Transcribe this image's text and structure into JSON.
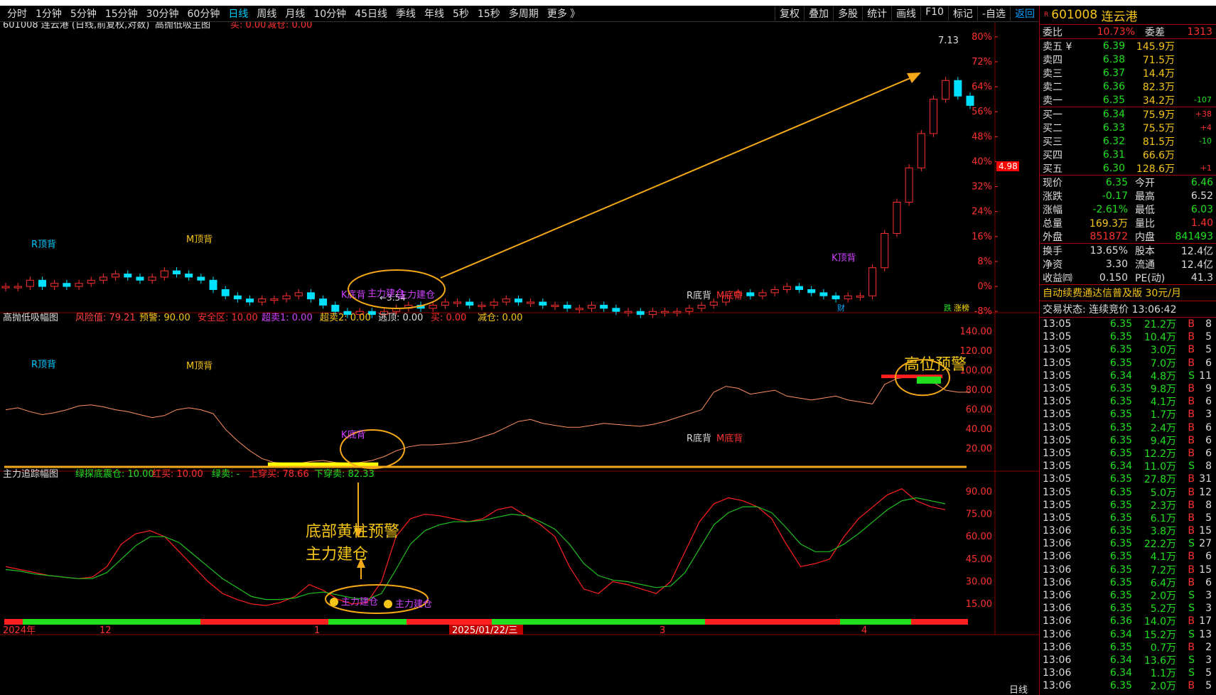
{
  "toolbar": {
    "periods": [
      "分时",
      "1分钟",
      "5分钟",
      "15分钟",
      "30分钟",
      "60分钟",
      "日线",
      "周线",
      "月线",
      "10分钟",
      "45日线",
      "季线",
      "年线",
      "5秒",
      "15秒",
      "多周期",
      "更多 》"
    ],
    "active_period": "日线",
    "right_items": [
      "复权",
      "叠加",
      "多股",
      "统计",
      "画线",
      "F10",
      "标记",
      "-自选",
      "返回"
    ]
  },
  "main_chart": {
    "title": "601008 连云港 (日线,前复权,对数)",
    "indicator_name": "高抛低吸主图",
    "buy_label": "买: 0.00",
    "reduce_label": "减仓: 0.00",
    "high_label": "7.13",
    "low_label": "←3.54",
    "price_tag": "4.98",
    "y_ticks": [
      "80%",
      "72%",
      "64%",
      "56%",
      "48%",
      "40%",
      "32%",
      "24%",
      "16%",
      "8%",
      "0%",
      "-8%"
    ],
    "signals": [
      "R顶背",
      "M顶背",
      "K底背",
      "主力建仓",
      "主力建仓",
      "K顶背",
      "R底背",
      "M底背"
    ],
    "events": [
      "财",
      "跌",
      "涨榜"
    ]
  },
  "sub1": {
    "name": "高抛低吸幅图",
    "params": [
      {
        "label": "风险值: 79.21",
        "color": "#ff4040"
      },
      {
        "label": "预警: 90.00",
        "color": "#f5c518"
      },
      {
        "label": "安全区: 10.00",
        "color": "#ff3030"
      },
      {
        "label": "超卖1: 0.00",
        "color": "#d040ff"
      },
      {
        "label": "超卖2: 0.00",
        "color": "#f5c518"
      },
      {
        "label": "逃顶: 0.00",
        "color": "#dddddd"
      },
      {
        "label": "买: 0.00",
        "color": "#ff3030"
      },
      {
        "label": "减仓: 0.00",
        "color": "#f5c518"
      }
    ],
    "y_ticks": [
      "140.00",
      "120.00",
      "100.00",
      "80.00",
      "60.00",
      "40.00",
      "20.00"
    ],
    "annotation_high": "高位预警",
    "signals": [
      "R顶背",
      "M顶背",
      "K底背",
      "R底背",
      "M底背"
    ]
  },
  "sub2": {
    "name": "主力追踪幅图",
    "params": [
      {
        "label": "绿探底震仓: 10.00",
        "color": "#20e020"
      },
      {
        "label": "红买: 10.00",
        "color": "#ff3030"
      },
      {
        "label": "绿卖: -",
        "color": "#20e020"
      },
      {
        "label": "上穿买: 78.66",
        "color": "#ff3030"
      },
      {
        "label": "下穿卖: 82.33",
        "color": "#20e020"
      }
    ],
    "y_ticks": [
      "90.00",
      "75.00",
      "60.00",
      "45.00",
      "30.00",
      "15.00"
    ],
    "annotation_line1": "底部黄柱预警",
    "annotation_line2": "主力建仓",
    "signals": [
      "主力建仓",
      "主力建仓"
    ]
  },
  "x_axis": {
    "labels": [
      "2024年",
      "12",
      "1",
      "2025/01/22/三",
      "3",
      "4"
    ],
    "period_label": "日线"
  },
  "chart_data": [
    {
      "type": "candlestick",
      "title": "601008 连云港 (日线,前复权,对数)",
      "ylabel": "%",
      "ylim": [
        -10,
        82
      ],
      "log_scale": true,
      "note_high": 7.13,
      "note_low": 3.54,
      "close_pct": [
        0,
        0,
        2,
        0,
        1,
        0,
        1,
        2,
        3,
        4,
        3,
        2,
        3,
        5,
        4,
        3,
        2,
        -1,
        -3,
        -4,
        -5,
        -4,
        -4,
        -3,
        -2,
        -4,
        -6,
        -8,
        -9,
        -8,
        -9,
        -8,
        -7,
        -6,
        -7,
        -6,
        -5,
        -5,
        -6,
        -6,
        -5,
        -4,
        -5,
        -5,
        -6,
        -6,
        -7,
        -7,
        -6,
        -7,
        -8,
        -8,
        -9,
        -8,
        -8,
        -8,
        -7,
        -6,
        -5,
        -3,
        -2,
        -3,
        -2,
        -1,
        0,
        -1,
        -2,
        -3,
        -4,
        -3,
        -3,
        6,
        17,
        27,
        38,
        49,
        60,
        66,
        61,
        58
      ]
    },
    {
      "type": "line",
      "name": "风险值",
      "ylim": [
        0,
        150
      ],
      "values": [
        60,
        62,
        58,
        55,
        57,
        60,
        64,
        65,
        63,
        60,
        58,
        55,
        52,
        54,
        60,
        62,
        60,
        56,
        40,
        28,
        18,
        10,
        6,
        5,
        5,
        7,
        8,
        6,
        5,
        6,
        8,
        12,
        18,
        22,
        24,
        24,
        25,
        26,
        28,
        32,
        36,
        42,
        48,
        50,
        46,
        44,
        42,
        42,
        44,
        46,
        45,
        44,
        43,
        45,
        48,
        52,
        56,
        60,
        78,
        84,
        82,
        76,
        78,
        80,
        74,
        72,
        70,
        72,
        74,
        70,
        68,
        66,
        86,
        92,
        94,
        92,
        88,
        80,
        78,
        78
      ]
    },
    {
      "type": "line",
      "name": "主力追踪",
      "ylim": [
        5,
        100
      ],
      "series": [
        {
          "name": "红线",
          "values": [
            40,
            38,
            36,
            34,
            33,
            32,
            33,
            40,
            55,
            62,
            64,
            60,
            50,
            40,
            30,
            22,
            18,
            15,
            14,
            16,
            20,
            28,
            24,
            18,
            15,
            16,
            30,
            60,
            72,
            75,
            74,
            72,
            70,
            72,
            78,
            80,
            74,
            68,
            60,
            40,
            25,
            22,
            30,
            28,
            25,
            22,
            30,
            50,
            70,
            82,
            86,
            84,
            80,
            72,
            55,
            40,
            42,
            45,
            60,
            72,
            80,
            88,
            92,
            84,
            80,
            78
          ]
        },
        {
          "name": "绿线",
          "values": [
            38,
            37,
            35,
            34,
            33,
            32,
            32,
            36,
            45,
            54,
            60,
            60,
            56,
            48,
            40,
            32,
            26,
            20,
            18,
            18,
            19,
            22,
            23,
            21,
            19,
            18,
            22,
            38,
            55,
            64,
            68,
            70,
            70,
            71,
            73,
            75,
            74,
            70,
            65,
            55,
            42,
            34,
            31,
            30,
            28,
            26,
            27,
            36,
            52,
            68,
            76,
            80,
            80,
            76,
            66,
            55,
            50,
            50,
            55,
            62,
            70,
            78,
            84,
            86,
            84,
            82
          ]
        }
      ]
    }
  ],
  "quote": {
    "code": "601008",
    "name": "连云港",
    "tag": "R",
    "wei_bi_label": "委比",
    "wei_bi": "10.73%",
    "wei_cha_label": "委差",
    "wei_cha": "1313",
    "asks": [
      {
        "label": "卖五 ¥",
        "price": "6.39",
        "vol": "145.9万",
        "chg": ""
      },
      {
        "label": "卖四",
        "price": "6.38",
        "vol": "71.5万",
        "chg": ""
      },
      {
        "label": "卖三",
        "price": "6.37",
        "vol": "14.4万",
        "chg": ""
      },
      {
        "label": "卖二",
        "price": "6.36",
        "vol": "82.3万",
        "chg": ""
      },
      {
        "label": "卖一",
        "price": "6.35",
        "vol": "34.2万",
        "chg": "-107"
      }
    ],
    "bids": [
      {
        "label": "买一",
        "price": "6.34",
        "vol": "75.9万",
        "chg": "+38"
      },
      {
        "label": "买二",
        "price": "6.33",
        "vol": "75.5万",
        "chg": "+4"
      },
      {
        "label": "买三",
        "price": "6.32",
        "vol": "81.5万",
        "chg": "-10"
      },
      {
        "label": "买四",
        "price": "6.31",
        "vol": "66.6万",
        "chg": ""
      },
      {
        "label": "买五",
        "price": "6.30",
        "vol": "128.6万",
        "chg": "+1"
      }
    ],
    "stats": [
      {
        "l1": "现价",
        "v1": "6.35",
        "c1": "#20e020",
        "l2": "今开",
        "v2": "6.46",
        "c2": "#20e020"
      },
      {
        "l1": "涨跌",
        "v1": "-0.17",
        "c1": "#20e020",
        "l2": "最高",
        "v2": "6.52",
        "c2": "#dddddd"
      },
      {
        "l1": "涨幅",
        "v1": "-2.61%",
        "c1": "#20e020",
        "l2": "最低",
        "v2": "6.03",
        "c2": "#20e020"
      },
      {
        "l1": "总量",
        "v1": "169.3万",
        "c1": "#f5c518",
        "l2": "量比",
        "v2": "1.40",
        "c2": "#ff3030"
      },
      {
        "l1": "外盘",
        "v1": "851872",
        "c1": "#ff3030",
        "l2": "内盘",
        "v2": "841493",
        "c2": "#20e020"
      }
    ],
    "stats2": [
      {
        "l1": "换手",
        "v1": "13.65%",
        "l2": "股本",
        "v2": "12.4亿"
      },
      {
        "l1": "净资",
        "v1": "3.30",
        "l2": "流通",
        "v2": "12.4亿"
      },
      {
        "l1": "收益㈣",
        "v1": "0.150",
        "l2": "PE(动)",
        "v2": "41.3"
      }
    ],
    "ad_text": "自动续费通达信普及版 30元/月",
    "status_text": "交易状态: 连续竞价 13:06:42"
  },
  "trades": [
    {
      "t": "13:05",
      "p": "6.35",
      "v": "21.2万",
      "d": "B",
      "c": "8"
    },
    {
      "t": "13:05",
      "p": "6.35",
      "v": "10.4万",
      "d": "B",
      "c": "5"
    },
    {
      "t": "13:05",
      "p": "6.35",
      "v": "3.0万",
      "d": "B",
      "c": "5"
    },
    {
      "t": "13:05",
      "p": "6.35",
      "v": "7.0万",
      "d": "B",
      "c": "6"
    },
    {
      "t": "13:05",
      "p": "6.34",
      "v": "4.8万",
      "d": "S",
      "c": "11"
    },
    {
      "t": "13:05",
      "p": "6.35",
      "v": "9.8万",
      "d": "B",
      "c": "9"
    },
    {
      "t": "13:05",
      "p": "6.35",
      "v": "4.1万",
      "d": "B",
      "c": "6"
    },
    {
      "t": "13:05",
      "p": "6.35",
      "v": "1.7万",
      "d": "B",
      "c": "3"
    },
    {
      "t": "13:05",
      "p": "6.35",
      "v": "2.4万",
      "d": "B",
      "c": "6"
    },
    {
      "t": "13:05",
      "p": "6.35",
      "v": "9.4万",
      "d": "B",
      "c": "6"
    },
    {
      "t": "13:05",
      "p": "6.35",
      "v": "12.2万",
      "d": "B",
      "c": "6"
    },
    {
      "t": "13:05",
      "p": "6.34",
      "v": "11.0万",
      "d": "S",
      "c": "8"
    },
    {
      "t": "13:05",
      "p": "6.35",
      "v": "27.8万",
      "d": "B",
      "c": "31"
    },
    {
      "t": "13:05",
      "p": "6.35",
      "v": "5.0万",
      "d": "B",
      "c": "12"
    },
    {
      "t": "13:05",
      "p": "6.35",
      "v": "2.3万",
      "d": "B",
      "c": "8"
    },
    {
      "t": "13:05",
      "p": "6.35",
      "v": "6.1万",
      "d": "B",
      "c": "5"
    },
    {
      "t": "13:06",
      "p": "6.35",
      "v": "3.8万",
      "d": "B",
      "c": "15"
    },
    {
      "t": "13:06",
      "p": "6.35",
      "v": "22.2万",
      "d": "S",
      "c": "27"
    },
    {
      "t": "13:06",
      "p": "6.35",
      "v": "4.1万",
      "d": "B",
      "c": "6"
    },
    {
      "t": "13:06",
      "p": "6.35",
      "v": "7.2万",
      "d": "B",
      "c": "15"
    },
    {
      "t": "13:06",
      "p": "6.35",
      "v": "6.4万",
      "d": "B",
      "c": "6"
    },
    {
      "t": "13:06",
      "p": "6.35",
      "v": "2.0万",
      "d": "S",
      "c": "3"
    },
    {
      "t": "13:06",
      "p": "6.35",
      "v": "5.2万",
      "d": "S",
      "c": "3"
    },
    {
      "t": "13:06",
      "p": "6.36",
      "v": "14.0万",
      "d": "B",
      "c": "17"
    },
    {
      "t": "13:06",
      "p": "6.34",
      "v": "15.2万",
      "d": "S",
      "c": "13"
    },
    {
      "t": "13:06",
      "p": "6.35",
      "v": "0.7万",
      "d": "B",
      "c": "2"
    },
    {
      "t": "13:06",
      "p": "6.34",
      "v": "13.6万",
      "d": "S",
      "c": "3"
    },
    {
      "t": "13:06",
      "p": "6.34",
      "v": "1.1万",
      "d": "S",
      "c": "5"
    },
    {
      "t": "13:06",
      "p": "6.35",
      "v": "2.0万",
      "d": "B",
      "c": "5"
    }
  ],
  "colors": {
    "up": "#ff3030",
    "down": "#00e0ff",
    "accent": "#f5c518",
    "buy_bar": "#ffff00"
  }
}
